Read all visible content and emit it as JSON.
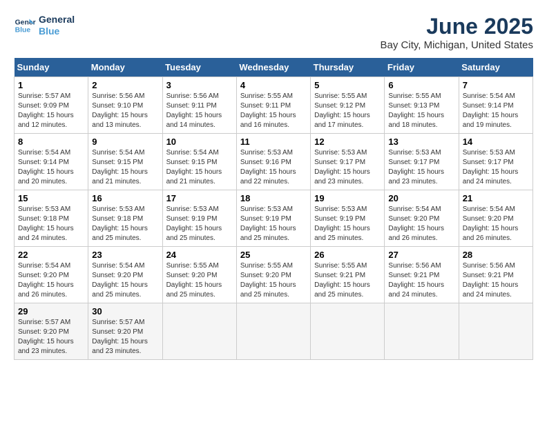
{
  "header": {
    "logo_line1": "General",
    "logo_line2": "Blue",
    "title": "June 2025",
    "subtitle": "Bay City, Michigan, United States"
  },
  "days_of_week": [
    "Sunday",
    "Monday",
    "Tuesday",
    "Wednesday",
    "Thursday",
    "Friday",
    "Saturday"
  ],
  "weeks": [
    [
      {
        "num": "1",
        "info": "Sunrise: 5:57 AM\nSunset: 9:09 PM\nDaylight: 15 hours\nand 12 minutes."
      },
      {
        "num": "2",
        "info": "Sunrise: 5:56 AM\nSunset: 9:10 PM\nDaylight: 15 hours\nand 13 minutes."
      },
      {
        "num": "3",
        "info": "Sunrise: 5:56 AM\nSunset: 9:11 PM\nDaylight: 15 hours\nand 14 minutes."
      },
      {
        "num": "4",
        "info": "Sunrise: 5:55 AM\nSunset: 9:11 PM\nDaylight: 15 hours\nand 16 minutes."
      },
      {
        "num": "5",
        "info": "Sunrise: 5:55 AM\nSunset: 9:12 PM\nDaylight: 15 hours\nand 17 minutes."
      },
      {
        "num": "6",
        "info": "Sunrise: 5:55 AM\nSunset: 9:13 PM\nDaylight: 15 hours\nand 18 minutes."
      },
      {
        "num": "7",
        "info": "Sunrise: 5:54 AM\nSunset: 9:14 PM\nDaylight: 15 hours\nand 19 minutes."
      }
    ],
    [
      {
        "num": "8",
        "info": "Sunrise: 5:54 AM\nSunset: 9:14 PM\nDaylight: 15 hours\nand 20 minutes."
      },
      {
        "num": "9",
        "info": "Sunrise: 5:54 AM\nSunset: 9:15 PM\nDaylight: 15 hours\nand 21 minutes."
      },
      {
        "num": "10",
        "info": "Sunrise: 5:54 AM\nSunset: 9:15 PM\nDaylight: 15 hours\nand 21 minutes."
      },
      {
        "num": "11",
        "info": "Sunrise: 5:53 AM\nSunset: 9:16 PM\nDaylight: 15 hours\nand 22 minutes."
      },
      {
        "num": "12",
        "info": "Sunrise: 5:53 AM\nSunset: 9:17 PM\nDaylight: 15 hours\nand 23 minutes."
      },
      {
        "num": "13",
        "info": "Sunrise: 5:53 AM\nSunset: 9:17 PM\nDaylight: 15 hours\nand 23 minutes."
      },
      {
        "num": "14",
        "info": "Sunrise: 5:53 AM\nSunset: 9:17 PM\nDaylight: 15 hours\nand 24 minutes."
      }
    ],
    [
      {
        "num": "15",
        "info": "Sunrise: 5:53 AM\nSunset: 9:18 PM\nDaylight: 15 hours\nand 24 minutes."
      },
      {
        "num": "16",
        "info": "Sunrise: 5:53 AM\nSunset: 9:18 PM\nDaylight: 15 hours\nand 25 minutes."
      },
      {
        "num": "17",
        "info": "Sunrise: 5:53 AM\nSunset: 9:19 PM\nDaylight: 15 hours\nand 25 minutes."
      },
      {
        "num": "18",
        "info": "Sunrise: 5:53 AM\nSunset: 9:19 PM\nDaylight: 15 hours\nand 25 minutes."
      },
      {
        "num": "19",
        "info": "Sunrise: 5:53 AM\nSunset: 9:19 PM\nDaylight: 15 hours\nand 25 minutes."
      },
      {
        "num": "20",
        "info": "Sunrise: 5:54 AM\nSunset: 9:20 PM\nDaylight: 15 hours\nand 26 minutes."
      },
      {
        "num": "21",
        "info": "Sunrise: 5:54 AM\nSunset: 9:20 PM\nDaylight: 15 hours\nand 26 minutes."
      }
    ],
    [
      {
        "num": "22",
        "info": "Sunrise: 5:54 AM\nSunset: 9:20 PM\nDaylight: 15 hours\nand 26 minutes."
      },
      {
        "num": "23",
        "info": "Sunrise: 5:54 AM\nSunset: 9:20 PM\nDaylight: 15 hours\nand 25 minutes."
      },
      {
        "num": "24",
        "info": "Sunrise: 5:55 AM\nSunset: 9:20 PM\nDaylight: 15 hours\nand 25 minutes."
      },
      {
        "num": "25",
        "info": "Sunrise: 5:55 AM\nSunset: 9:20 PM\nDaylight: 15 hours\nand 25 minutes."
      },
      {
        "num": "26",
        "info": "Sunrise: 5:55 AM\nSunset: 9:21 PM\nDaylight: 15 hours\nand 25 minutes."
      },
      {
        "num": "27",
        "info": "Sunrise: 5:56 AM\nSunset: 9:21 PM\nDaylight: 15 hours\nand 24 minutes."
      },
      {
        "num": "28",
        "info": "Sunrise: 5:56 AM\nSunset: 9:21 PM\nDaylight: 15 hours\nand 24 minutes."
      }
    ],
    [
      {
        "num": "29",
        "info": "Sunrise: 5:57 AM\nSunset: 9:20 PM\nDaylight: 15 hours\nand 23 minutes."
      },
      {
        "num": "30",
        "info": "Sunrise: 5:57 AM\nSunset: 9:20 PM\nDaylight: 15 hours\nand 23 minutes."
      },
      null,
      null,
      null,
      null,
      null
    ]
  ]
}
